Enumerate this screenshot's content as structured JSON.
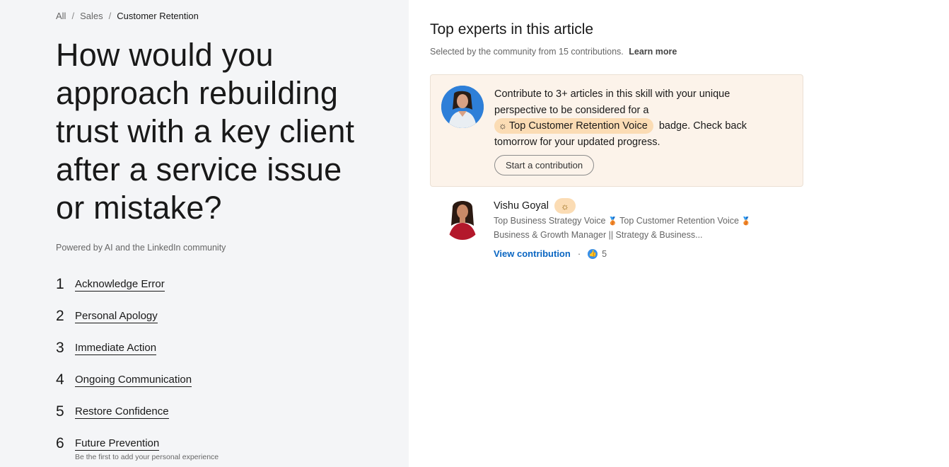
{
  "breadcrumb": {
    "items": [
      "All",
      "Sales"
    ],
    "current": "Customer Retention"
  },
  "article": {
    "title": "How would you approach rebuilding trust with a key client after a service issue or mistake?",
    "powered_by": "Powered by AI and the LinkedIn community",
    "toc": [
      {
        "number": "1",
        "label": "Acknowledge Error"
      },
      {
        "number": "2",
        "label": "Personal Apology"
      },
      {
        "number": "3",
        "label": "Immediate Action"
      },
      {
        "number": "4",
        "label": "Ongoing Communication"
      },
      {
        "number": "5",
        "label": "Restore Confidence"
      },
      {
        "number": "6",
        "label": "Future Prevention",
        "sub": "Be the first to add your personal experience"
      }
    ]
  },
  "experts_panel": {
    "title": "Top experts in this article",
    "subtitle": "Selected by the community from 15 contributions.",
    "learn_more": "Learn more",
    "contribute_card": {
      "text_before": "Contribute to 3+ articles in this skill with your unique perspective to be considered for a",
      "badge_label": "Top Customer Retention Voice",
      "text_after": "badge. Check back tomorrow for your updated progress.",
      "button_label": "Start a contribution"
    },
    "experts": [
      {
        "name": "Vishu Goyal",
        "badge_icon": "sun-icon",
        "headline_1a": "Top Business Strategy Voice",
        "headline_1b": "Top Customer Retention Voice",
        "headline_2": "Business & Growth Manager || Strategy & Business...",
        "view_label": "View contribution",
        "likes": "5"
      }
    ]
  },
  "colors": {
    "left_bg": "#f4f5f7",
    "card_bg": "#fcf3ea",
    "badge_bg": "#fbdcb4",
    "link_blue": "#0a66c2"
  }
}
